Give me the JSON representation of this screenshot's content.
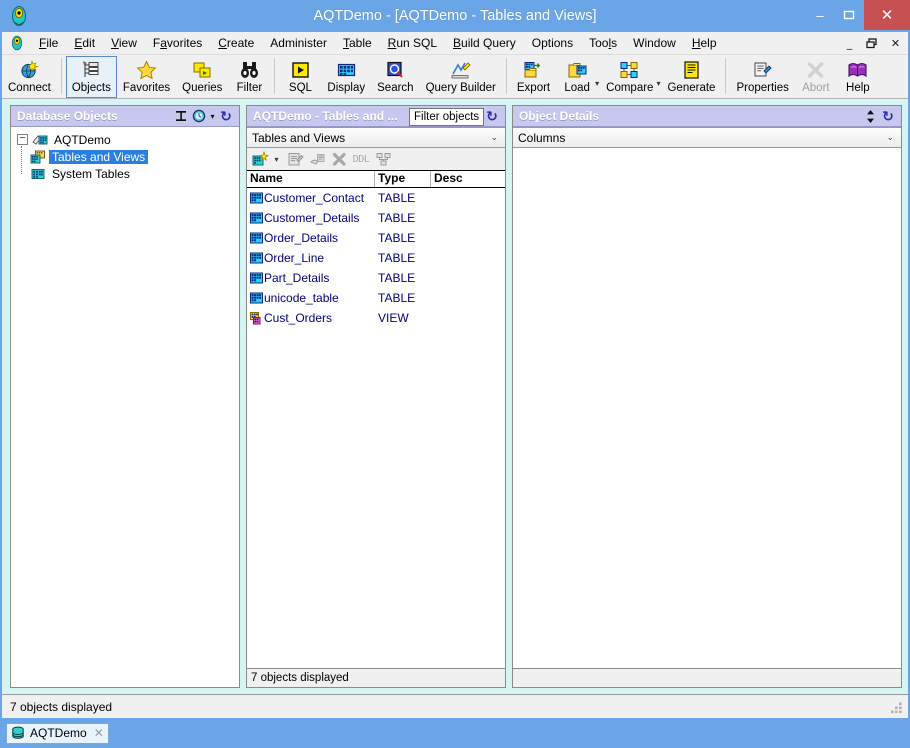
{
  "window": {
    "title": "AQTDemo - [AQTDemo - Tables and Views]",
    "app_icon": "aqt-app-icon",
    "minimize": "–",
    "maximize": "❐",
    "close": "✕"
  },
  "menubar": {
    "icon": "aqt-menu-icon",
    "items": [
      {
        "pre": "",
        "acc": "F",
        "post": "ile"
      },
      {
        "pre": "",
        "acc": "E",
        "post": "dit"
      },
      {
        "pre": "",
        "acc": "V",
        "post": "iew"
      },
      {
        "pre": "F",
        "acc": "a",
        "post": "vorites"
      },
      {
        "pre": "",
        "acc": "C",
        "post": "reate"
      },
      {
        "pre": "A",
        "acc": "",
        "post": "dminister"
      },
      {
        "pre": "",
        "acc": "T",
        "post": "able"
      },
      {
        "pre": "",
        "acc": "R",
        "post": "un SQL"
      },
      {
        "pre": "",
        "acc": "B",
        "post": "uild Query"
      },
      {
        "pre": "O",
        "acc": "",
        "post": "ptions"
      },
      {
        "pre": "Too",
        "acc": "l",
        "post": "s"
      },
      {
        "pre": "W",
        "acc": "",
        "post": "indow"
      },
      {
        "pre": "",
        "acc": "H",
        "post": "elp"
      }
    ],
    "mdi_minimize": "_",
    "mdi_restore": "❐",
    "mdi_close": "✕"
  },
  "toolbar": {
    "buttons": [
      {
        "label": "Connect",
        "icon": "connect-globe-icon",
        "selected": false,
        "disabled": false,
        "dropdown": false
      },
      {
        "label": "Objects",
        "icon": "objects-tree-icon",
        "selected": true,
        "disabled": false,
        "dropdown": false
      },
      {
        "label": "Favorites",
        "icon": "favorites-star-icon",
        "selected": false,
        "disabled": false,
        "dropdown": false
      },
      {
        "label": "Queries",
        "icon": "queries-icon",
        "selected": false,
        "disabled": false,
        "dropdown": false
      },
      {
        "label": "Filter",
        "icon": "filter-binoculars-icon",
        "selected": false,
        "disabled": false,
        "dropdown": false
      },
      {
        "label": "SQL",
        "icon": "sql-run-icon",
        "selected": false,
        "disabled": false,
        "dropdown": false
      },
      {
        "label": "Display",
        "icon": "display-grid-icon",
        "selected": false,
        "disabled": false,
        "dropdown": false
      },
      {
        "label": "Search",
        "icon": "search-icon",
        "selected": false,
        "disabled": false,
        "dropdown": false
      },
      {
        "label": "Query Builder",
        "icon": "query-builder-icon",
        "selected": false,
        "disabled": false,
        "dropdown": false
      },
      {
        "label": "Export",
        "icon": "export-icon",
        "selected": false,
        "disabled": false,
        "dropdown": false
      },
      {
        "label": "Load",
        "icon": "load-icon",
        "selected": false,
        "disabled": false,
        "dropdown": true
      },
      {
        "label": "Compare",
        "icon": "compare-icon",
        "selected": false,
        "disabled": false,
        "dropdown": true
      },
      {
        "label": "Generate",
        "icon": "generate-icon",
        "selected": false,
        "disabled": false,
        "dropdown": false
      },
      {
        "label": "Properties",
        "icon": "properties-icon",
        "selected": false,
        "disabled": false,
        "dropdown": false
      },
      {
        "label": "Abort",
        "icon": "abort-x-icon",
        "selected": false,
        "disabled": true,
        "dropdown": false
      },
      {
        "label": "Help",
        "icon": "help-book-icon",
        "selected": false,
        "disabled": false,
        "dropdown": false
      }
    ],
    "separators_after": [
      0,
      4,
      8,
      12
    ]
  },
  "left_panel": {
    "title": "Database Objects",
    "icons": [
      "collapse-ibeam-icon",
      "history-clock-icon",
      "refresh-icon"
    ],
    "clock_dropdown": "▾",
    "refresh_glyph": "↻",
    "tree": {
      "root": {
        "label": "AQTDemo",
        "icon": "database-connection-icon",
        "expander": "–"
      },
      "children": [
        {
          "label": "Tables and Views",
          "icon": "tables-views-icon",
          "selected": true
        },
        {
          "label": "System Tables",
          "icon": "system-tables-icon",
          "selected": false
        }
      ]
    }
  },
  "middle_panel": {
    "title": "AQTDemo - Tables and ...",
    "tooltip": "Filter objects",
    "refresh_glyph": "↻",
    "combo_value": "Tables and Views",
    "combo_arrow": "⌄",
    "mini_toolbar": [
      {
        "icon": "new-object-icon",
        "disabled": false,
        "dropdown": true
      },
      {
        "icon": "properties-icon",
        "disabled": true,
        "dropdown": false
      },
      {
        "icon": "edit-script-icon",
        "disabled": true,
        "dropdown": false
      },
      {
        "icon": "delete-x-icon",
        "disabled": true,
        "dropdown": false
      },
      {
        "icon": "ddl-icon",
        "disabled": true,
        "dropdown": false
      },
      {
        "icon": "relationships-icon",
        "disabled": true,
        "dropdown": false
      }
    ],
    "columns": [
      "Name",
      "Type",
      "Desc"
    ],
    "rows": [
      {
        "name": "Customer_Contact",
        "type": "TABLE",
        "desc": "",
        "icon": "table-icon"
      },
      {
        "name": "Customer_Details",
        "type": "TABLE",
        "desc": "",
        "icon": "table-icon"
      },
      {
        "name": "Order_Details",
        "type": "TABLE",
        "desc": "",
        "icon": "table-icon"
      },
      {
        "name": "Order_Line",
        "type": "TABLE",
        "desc": "",
        "icon": "table-icon"
      },
      {
        "name": "Part_Details",
        "type": "TABLE",
        "desc": "",
        "icon": "table-icon"
      },
      {
        "name": "unicode_table",
        "type": "TABLE",
        "desc": "",
        "icon": "table-icon"
      },
      {
        "name": "Cust_Orders",
        "type": "VIEW",
        "desc": "",
        "icon": "view-icon"
      }
    ],
    "footer": "7 objects displayed"
  },
  "right_panel": {
    "title": "Object Details",
    "sort_glyph": "⬍",
    "refresh_glyph": "↻",
    "combo_value": "Columns",
    "combo_arrow": "⌄"
  },
  "statusbar": {
    "text": "7 objects displayed",
    "grip": "resize-grip-icon"
  },
  "taskbar": {
    "tabs": [
      {
        "label": "AQTDemo",
        "icon": "database-icon",
        "close": "✕",
        "active": true
      }
    ]
  },
  "colors": {
    "window_frame": "#6aa5e8",
    "panel_header": "#c8cced",
    "close_button": "#c75050",
    "tree_selection": "#2a7fe0",
    "list_text": "#000080",
    "toolbar_bg": "#f0f0f0"
  }
}
